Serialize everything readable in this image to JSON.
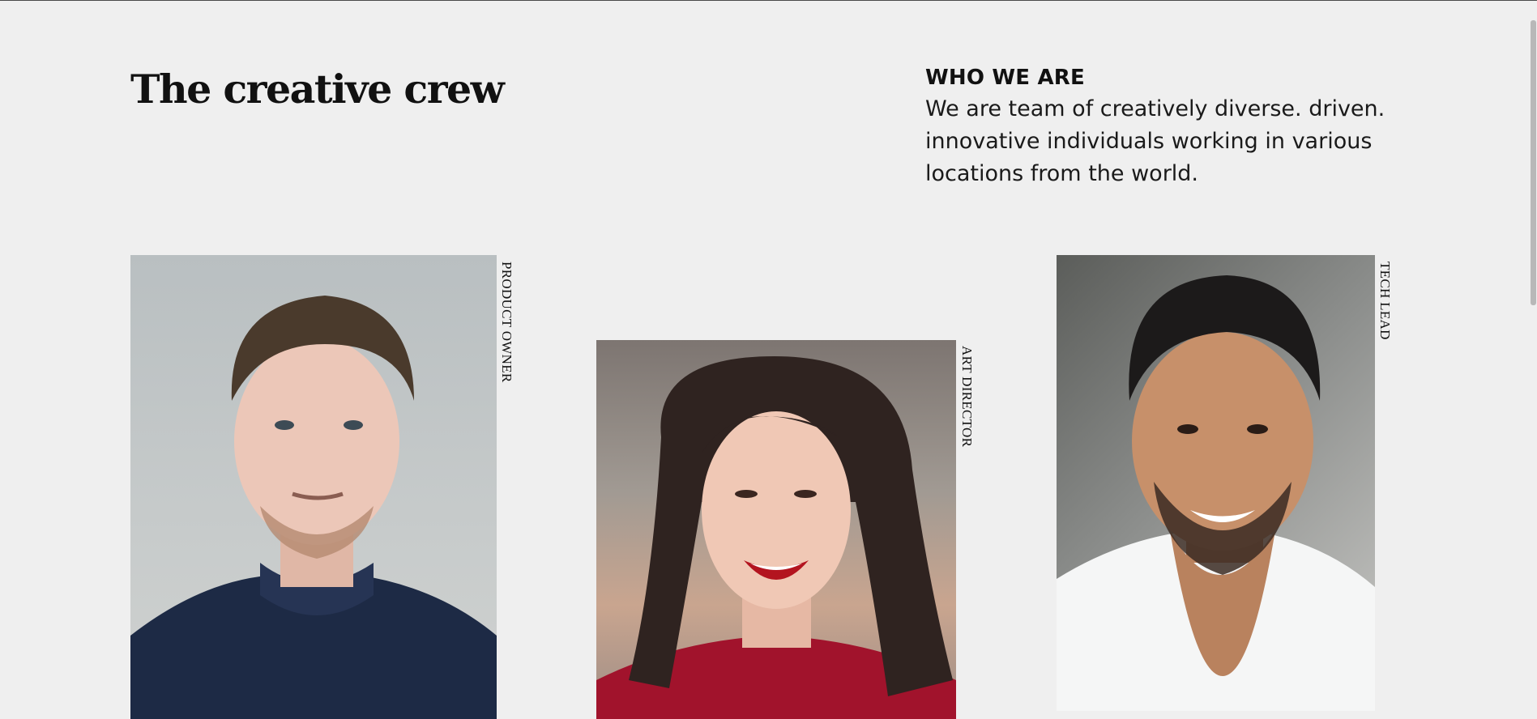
{
  "header": {
    "title": "The creative crew"
  },
  "about": {
    "heading": "WHO WE ARE",
    "text": "We are team of creatively diverse. driven. innovative individuals working in various locations from the world."
  },
  "team": [
    {
      "role": "PRODUCT OWNER"
    },
    {
      "role": "ART DIRECTOR"
    },
    {
      "role": "TECH LEAD"
    }
  ]
}
